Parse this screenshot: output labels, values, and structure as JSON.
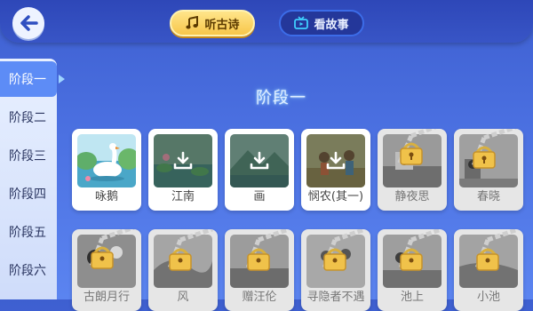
{
  "header": {
    "tabs": [
      {
        "label": "听古诗",
        "icon": "music-note-icon",
        "active": true
      },
      {
        "label": "看故事",
        "icon": "tv-icon",
        "active": false
      }
    ]
  },
  "sidebar": {
    "items": [
      {
        "label": "阶段一",
        "active": true
      },
      {
        "label": "阶段二"
      },
      {
        "label": "阶段三"
      },
      {
        "label": "阶段四"
      },
      {
        "label": "阶段五"
      },
      {
        "label": "阶段六"
      }
    ]
  },
  "main": {
    "title": "阶段一",
    "cards": [
      {
        "label": "咏鹅",
        "state": "available"
      },
      {
        "label": "江南",
        "state": "download"
      },
      {
        "label": "画",
        "state": "download"
      },
      {
        "label": "悯农(其一)",
        "state": "download"
      },
      {
        "label": "静夜思",
        "state": "locked"
      },
      {
        "label": "春晓",
        "state": "locked"
      },
      {
        "label": "古朗月行",
        "state": "locked"
      },
      {
        "label": "风",
        "state": "locked"
      },
      {
        "label": "赠汪伦",
        "state": "locked"
      },
      {
        "label": "寻隐者不遇",
        "state": "locked"
      },
      {
        "label": "池上",
        "state": "locked"
      },
      {
        "label": "小池",
        "state": "locked"
      }
    ]
  },
  "colors": {
    "accent": "#5d8cf6",
    "tab_active": "#f7c64a",
    "background": "#4a6fe0"
  }
}
